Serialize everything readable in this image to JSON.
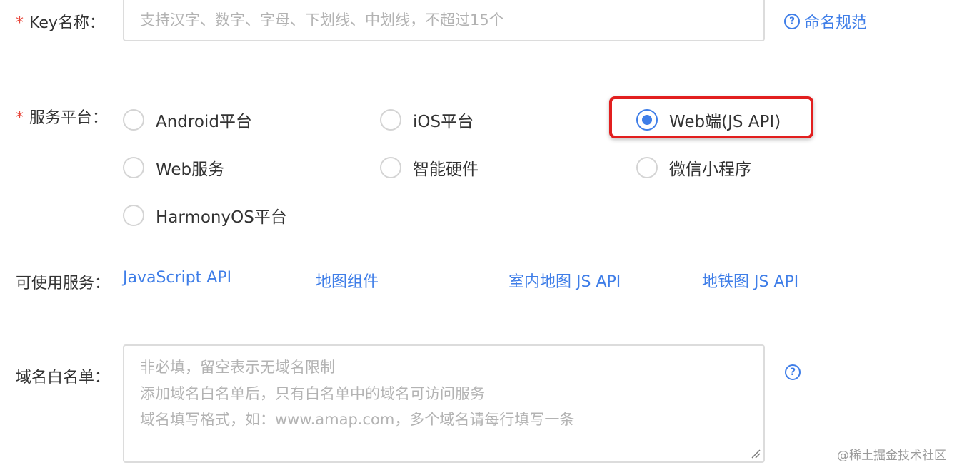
{
  "key_name": {
    "label": "Key名称：",
    "required_mark": "*",
    "placeholder": "支持汉字、数字、字母、下划线、中划线，不超过15个",
    "help_link": "命名规范"
  },
  "platform": {
    "label": "服务平台：",
    "required_mark": "*",
    "options": [
      {
        "label": "Android平台",
        "checked": false
      },
      {
        "label": "iOS平台",
        "checked": false
      },
      {
        "label": "Web端(JS API)",
        "checked": true
      },
      {
        "label": "Web服务",
        "checked": false
      },
      {
        "label": "智能硬件",
        "checked": false
      },
      {
        "label": "微信小程序",
        "checked": false
      },
      {
        "label": "HarmonyOS平台",
        "checked": false
      }
    ]
  },
  "services": {
    "label": "可使用服务：",
    "links": [
      "JavaScript API",
      "地图组件",
      "室内地图 JS API",
      "地铁图 JS API"
    ]
  },
  "whitelist": {
    "label": "域名白名单：",
    "placeholder_lines": [
      "非必填，留空表示无域名限制",
      "添加域名白名单后，只有白名单中的域名可访问服务",
      "域名填写格式，如：www.amap.com，多个域名请每行填写一条"
    ]
  },
  "watermark": "@稀土掘金技术社区",
  "colors": {
    "accent": "#3f7ee8",
    "required": "#e8483d",
    "highlight": "#e21f1f"
  }
}
